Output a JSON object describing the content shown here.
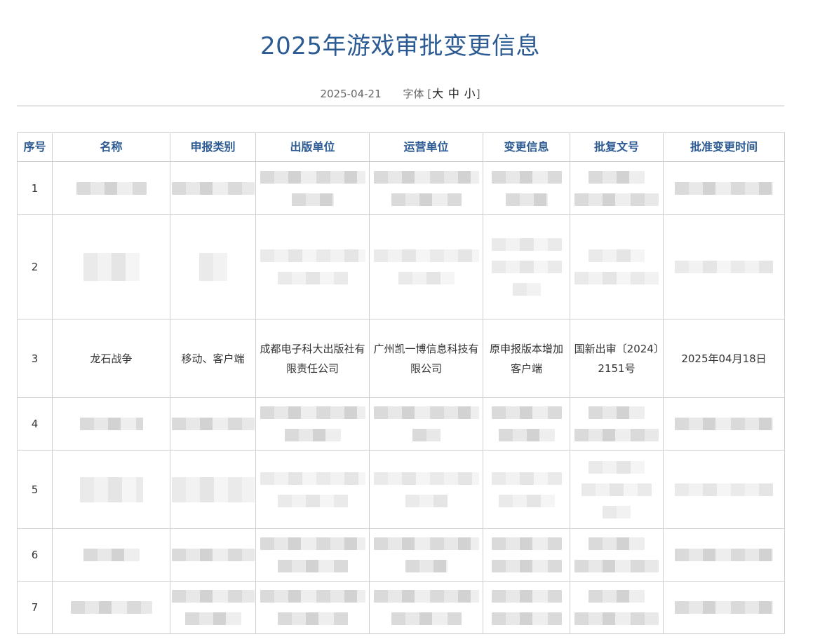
{
  "page": {
    "title": "2025年游戏审批变更信息",
    "date": "2025-04-21",
    "font_size_label": "字体",
    "font_size_open": "[",
    "font_size_close": "]",
    "font_sizes": [
      "大",
      "中",
      "小"
    ]
  },
  "table": {
    "headers": [
      "序号",
      "名称",
      "申报类别",
      "出版单位",
      "运营单位",
      "变更信息",
      "批复文号",
      "批准变更时间"
    ],
    "rows": [
      {
        "idx": "1"
      },
      {
        "idx": "2"
      },
      {
        "idx": "3",
        "name": "龙石战争",
        "category": "移动、客户端",
        "publisher": "成都电子科大出版社有限责任公司",
        "operator": "广州凯一博信息科技有限公司",
        "change": "原申报版本增加客户端",
        "approval_no": "国新出审〔2024〕2151号",
        "approval_date": "2025年04月18日"
      },
      {
        "idx": "4"
      },
      {
        "idx": "5"
      },
      {
        "idx": "6"
      },
      {
        "idx": "7"
      }
    ]
  }
}
